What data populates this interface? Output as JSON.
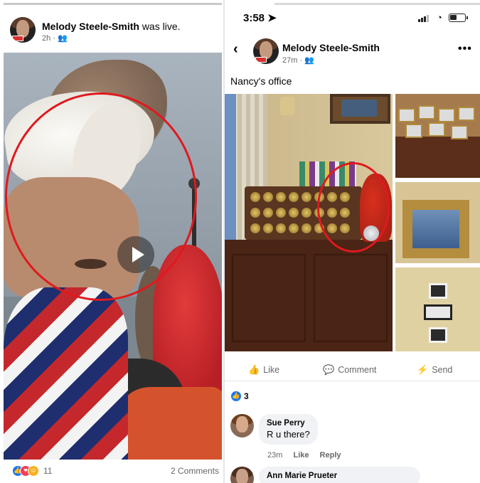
{
  "left_post": {
    "author": "Melody Steele-Smith",
    "action": "was live.",
    "time": "2h",
    "privacy_icon": "friends-icon",
    "reaction_count": "11",
    "comments_count": "2 Comments"
  },
  "right_post": {
    "status_time": "3:58",
    "author": "Melody Steele-Smith",
    "time": "27m",
    "privacy_icon": "friends-icon",
    "caption": "Nancy's office",
    "actions": {
      "like": "Like",
      "comment": "Comment",
      "send": "Send"
    },
    "reaction_count": "3",
    "comments": [
      {
        "name": "Sue Perry",
        "text": "R u there?",
        "time": "23m",
        "like": "Like",
        "reply": "Reply"
      },
      {
        "name": "Ann Marie Prueter"
      }
    ]
  },
  "colors": {
    "annotation_circle": "#e0191e",
    "facebook_blue": "#1877f2",
    "meta_gray": "#65676b"
  }
}
